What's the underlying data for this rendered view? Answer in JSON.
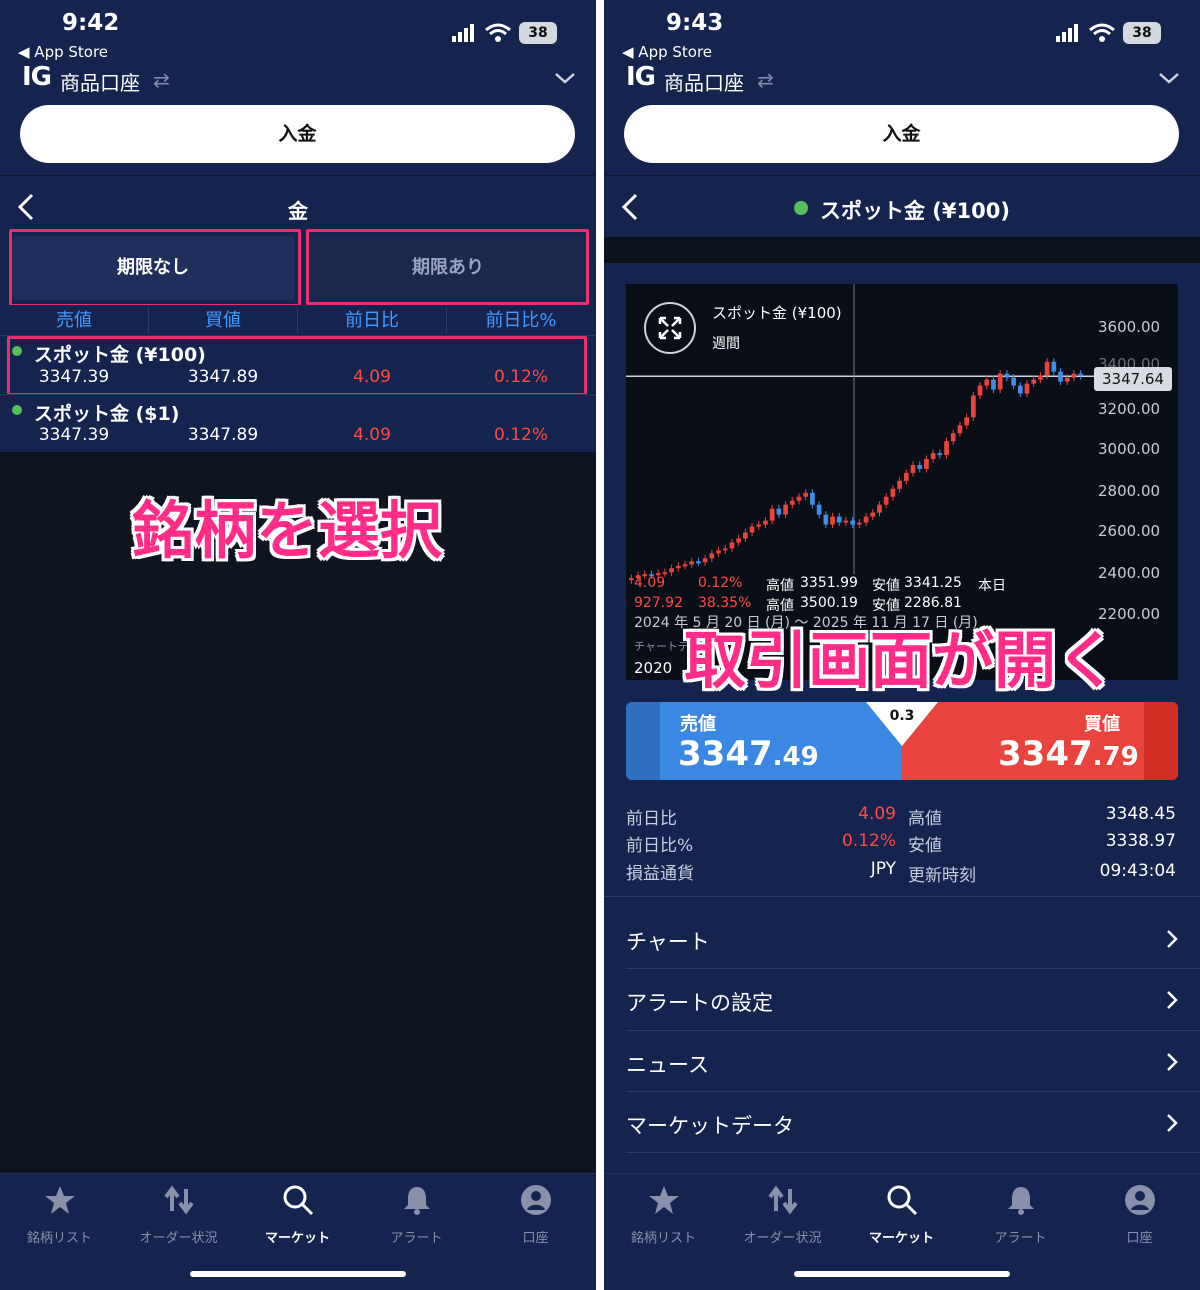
{
  "left": {
    "status": {
      "time": "9:42",
      "back_app": "◀ App Store",
      "battery": "38"
    },
    "header": {
      "logo": "IG",
      "account": "商品口座",
      "deposit": "入金"
    },
    "subheader": {
      "title": "金"
    },
    "tabs": [
      {
        "label": "期限なし"
      },
      {
        "label": "期限あり"
      }
    ],
    "columns": [
      "売値",
      "買値",
      "前日比",
      "前日比%"
    ],
    "rows": [
      {
        "name": "スポット金 (¥100)",
        "bid": "3347.39",
        "ask": "3347.89",
        "change": "4.09",
        "pct": "0.12%"
      },
      {
        "name": "スポット金 ($1)",
        "bid": "3347.39",
        "ask": "3347.89",
        "change": "4.09",
        "pct": "0.12%"
      }
    ],
    "annotation": "銘柄を選択"
  },
  "right": {
    "status": {
      "time": "9:43",
      "back_app": "◀ App Store",
      "battery": "38"
    },
    "header": {
      "logo": "IG",
      "account": "商品口座",
      "deposit": "入金"
    },
    "subheader": {
      "title": "スポット金 (¥100)"
    },
    "chart": {
      "name": "スポット金 (¥100)",
      "period": "週間",
      "price_tag": "3347.64",
      "y_ticks": [
        "3600.00",
        "3400.00",
        "3200.00",
        "3000.00",
        "2800.00",
        "2600.00",
        "2400.00",
        "2200.00"
      ],
      "stat1": {
        "change": "4.09",
        "pct": "0.12%",
        "high_label": "高値",
        "high": "3351.99",
        "low_label": "安値",
        "low": "3341.25",
        "period": "本日"
      },
      "stat2": {
        "change": "927.92",
        "pct": "38.35%",
        "high_label": "高値",
        "high": "3500.19",
        "low_label": "安値",
        "low": "2286.81"
      },
      "date_line": "2024 年 5 月 20 日 (月) 〜 2025 年 11 月 17 日 (月)",
      "small_line": "チャートデータ",
      "year_label": "2020"
    },
    "chart_data": {
      "type": "candlestick",
      "y_ticks": [
        3600,
        3400,
        3200,
        3000,
        2800,
        2600,
        2400,
        2200
      ],
      "ylim": [
        2150,
        3700
      ],
      "close": [
        2330,
        2345,
        2350,
        2348,
        2355,
        2360,
        2380,
        2392,
        2400,
        2415,
        2410,
        2430,
        2455,
        2470,
        2480,
        2510,
        2530,
        2560,
        2590,
        2600,
        2620,
        2680,
        2650,
        2700,
        2720,
        2740,
        2760,
        2700,
        2650,
        2600,
        2640,
        2610,
        2620,
        2600,
        2610,
        2640,
        2660,
        2700,
        2740,
        2780,
        2820,
        2860,
        2900,
        2880,
        2930,
        2960,
        2950,
        3020,
        3060,
        3100,
        3140,
        3250,
        3300,
        3330,
        3280,
        3360,
        3340,
        3300,
        3260,
        3310,
        3330,
        3350,
        3420,
        3370,
        3320,
        3340,
        3360,
        3348
      ],
      "open": [
        2320,
        2330,
        2345,
        2350,
        2348,
        2355,
        2360,
        2380,
        2392,
        2400,
        2415,
        2410,
        2430,
        2455,
        2470,
        2480,
        2510,
        2530,
        2560,
        2590,
        2600,
        2620,
        2680,
        2650,
        2700,
        2720,
        2740,
        2760,
        2700,
        2650,
        2600,
        2640,
        2610,
        2620,
        2600,
        2610,
        2640,
        2660,
        2700,
        2740,
        2780,
        2820,
        2860,
        2900,
        2880,
        2930,
        2960,
        2950,
        3020,
        3060,
        3100,
        3140,
        3250,
        3300,
        3330,
        3280,
        3360,
        3340,
        3300,
        3260,
        3310,
        3330,
        3350,
        3420,
        3370,
        3320,
        3340,
        3360
      ]
    },
    "quote": {
      "bid_label": "売値",
      "bid_big": "3347",
      "bid_small": ".49",
      "ask_label": "買値",
      "ask_big": "3347",
      "ask_small": ".79",
      "spread": "0.3"
    },
    "details": [
      {
        "label": "前日比",
        "value": "4.09",
        "label2": "高値",
        "value2": "3348.45"
      },
      {
        "label": "前日比%",
        "value": "0.12%",
        "label2": "安値",
        "value2": "3338.97"
      },
      {
        "label": "損益通貨",
        "value": "JPY",
        "label2": "更新時刻",
        "value2": "09:43:04"
      }
    ],
    "menu": [
      "チャート",
      "アラートの設定",
      "ニュース",
      "マーケットデータ"
    ],
    "annotation": "取引画面が開く"
  },
  "tabbar": [
    {
      "label": "銘柄リスト",
      "icon": "star-icon"
    },
    {
      "label": "オーダー状況",
      "icon": "arrows-icon"
    },
    {
      "label": "マーケット",
      "icon": "search-icon"
    },
    {
      "label": "アラート",
      "icon": "bell-icon"
    },
    {
      "label": "口座",
      "icon": "account-icon"
    }
  ],
  "colors": {
    "navy": "#15234f",
    "blue": "#3f9cff",
    "red": "#ff4a45",
    "pink": "#ff2d87",
    "bid": "#3b87e4",
    "ask": "#e8443d"
  }
}
